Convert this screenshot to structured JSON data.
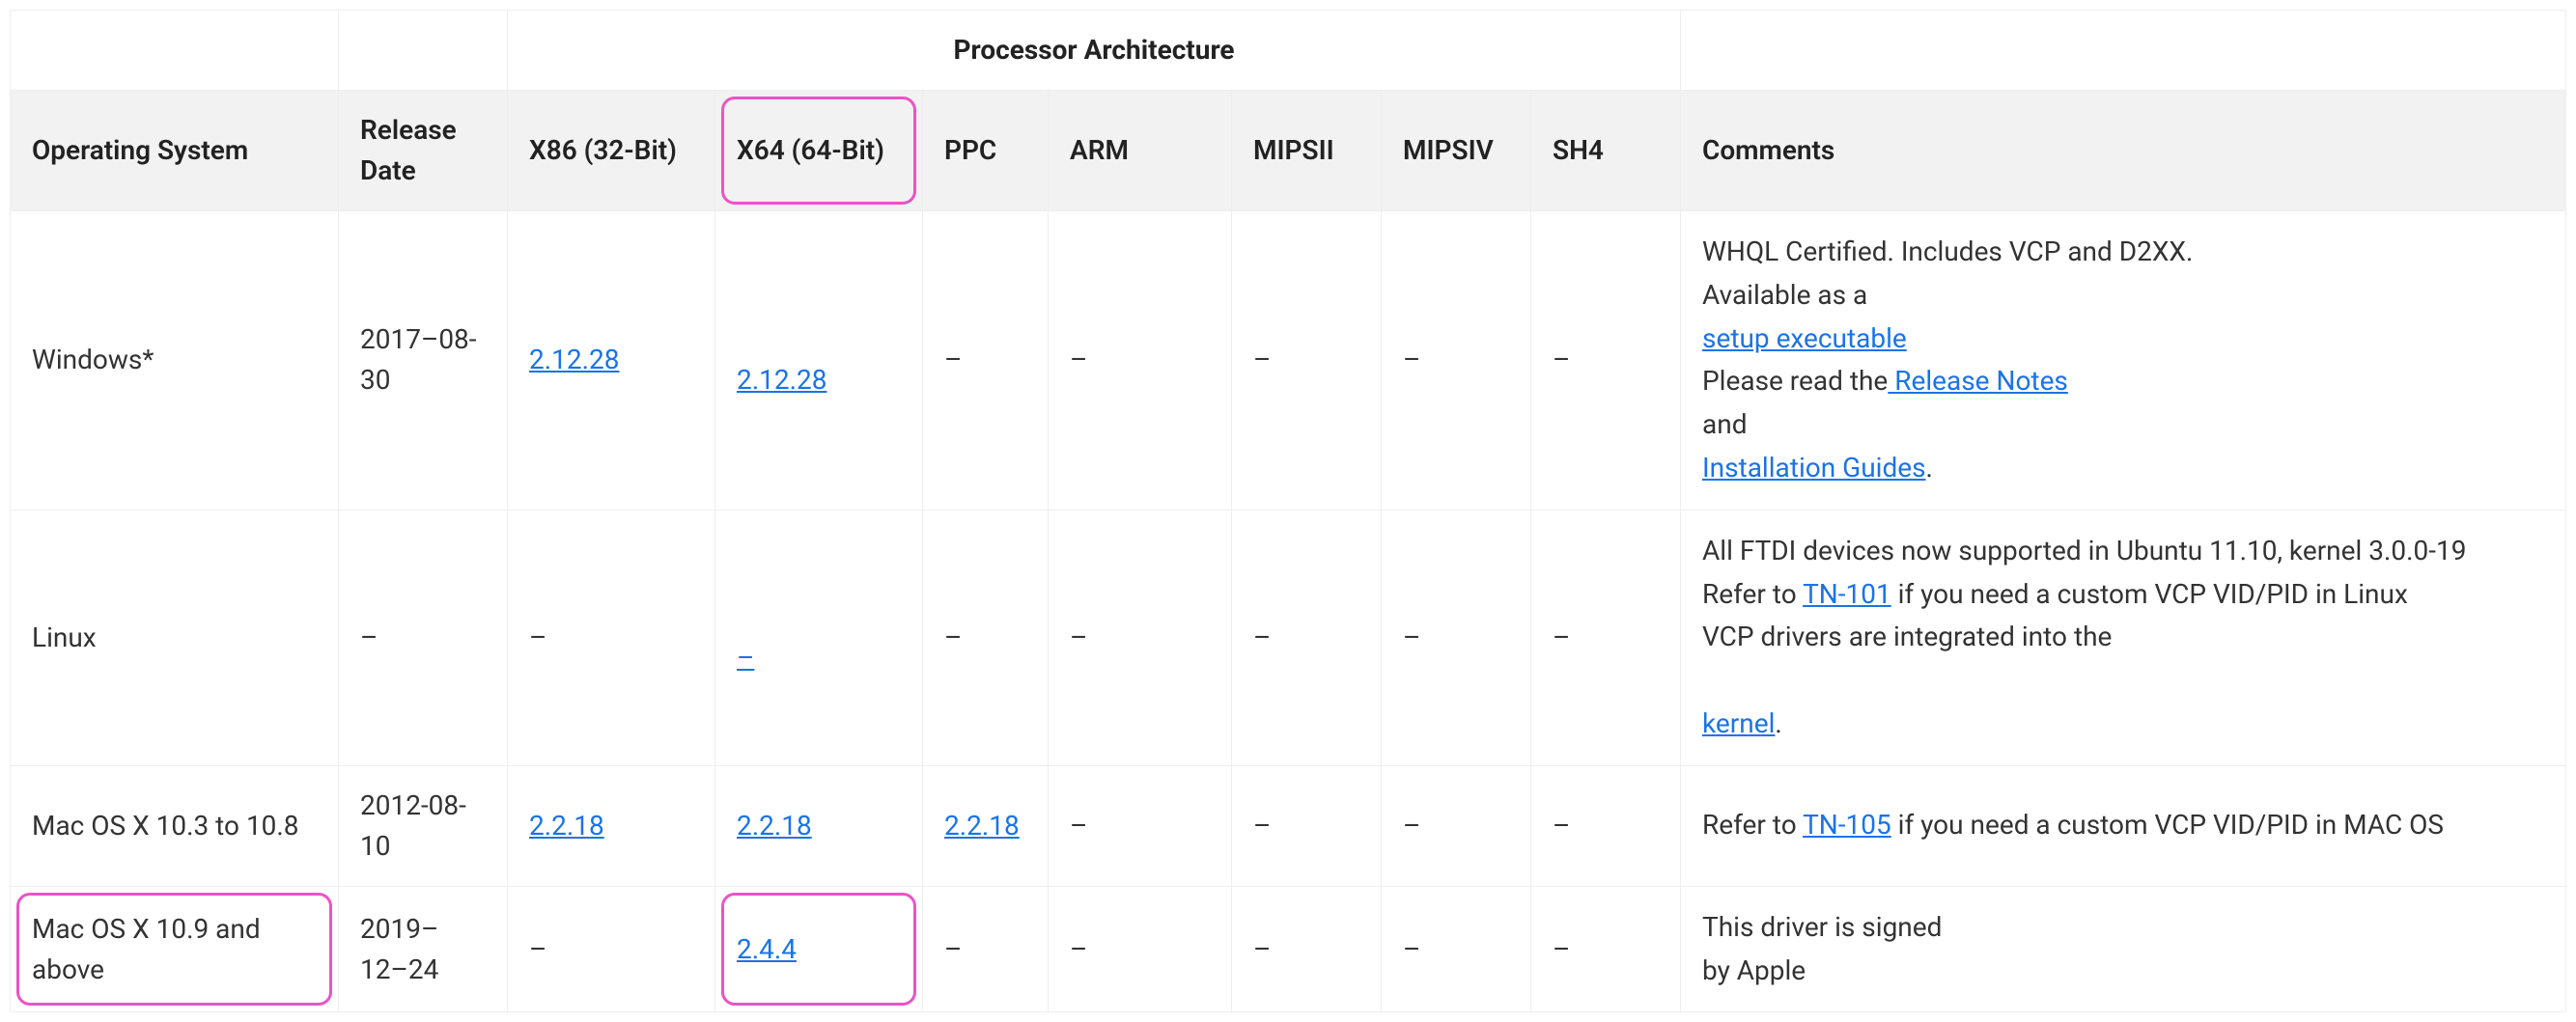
{
  "header": {
    "arch_title": "Processor Architecture",
    "os": "Operating System",
    "release_date": "Release Date",
    "x86": "X86 (32-Bit)",
    "x64": "X64 (64-Bit)",
    "ppc": "PPC",
    "arm": "ARM",
    "mipsii": "MIPSII",
    "mipsiv": "MIPSIV",
    "sh4": "SH4",
    "comments": "Comments"
  },
  "rows": {
    "windows": {
      "os": "Windows*",
      "date": "2017–08-30",
      "x86": "2.12.28",
      "x64": "2.12.28",
      "ppc": "–",
      "arm": "–",
      "mipsii": "–",
      "mipsiv": "–",
      "sh4": "–",
      "c1": "WHQL Certified. Includes VCP and D2XX.",
      "c2a": "Available as a",
      "c2b": "setup executable",
      "c3a": "Please read the",
      "c3b": " Release Notes",
      "c4": "and",
      "c5": "Installation Guides",
      "c5dot": "."
    },
    "linux": {
      "os": "Linux",
      "date": "–",
      "x86": "–",
      "x64": "–",
      "ppc": "–",
      "arm": "–",
      "mipsii": "–",
      "mipsiv": "–",
      "sh4": "–",
      "c1": "All FTDI devices now supported in Ubuntu 11.10, kernel 3.0.0-19",
      "c2a": "Refer to ",
      "c2b": "TN-101",
      "c2c": " if you need a custom VCP VID/PID in Linux",
      "c3": "VCP drivers are integrated into the",
      "c4": "kernel",
      "c4dot": "."
    },
    "mac_old": {
      "os": "Mac OS X 10.3 to 10.8",
      "date": "2012-08-10",
      "x86": "2.2.18",
      "x64": "2.2.18",
      "ppc": "2.2.18",
      "arm": "–",
      "mipsii": "–",
      "mipsiv": "–",
      "sh4": "–",
      "c1a": "Refer to ",
      "c1b": "TN-105",
      "c1c": " if you need a custom VCP VID/PID in MAC OS"
    },
    "mac_new": {
      "os": "Mac OS X 10.9 and above",
      "date": "2019–12–24",
      "x86": "–",
      "x64": "2.4.4",
      "ppc": "–",
      "arm": "–",
      "mipsii": "–",
      "mipsiv": "–",
      "sh4": "–",
      "c1": "This driver is signed",
      "c2": "by Apple"
    }
  }
}
